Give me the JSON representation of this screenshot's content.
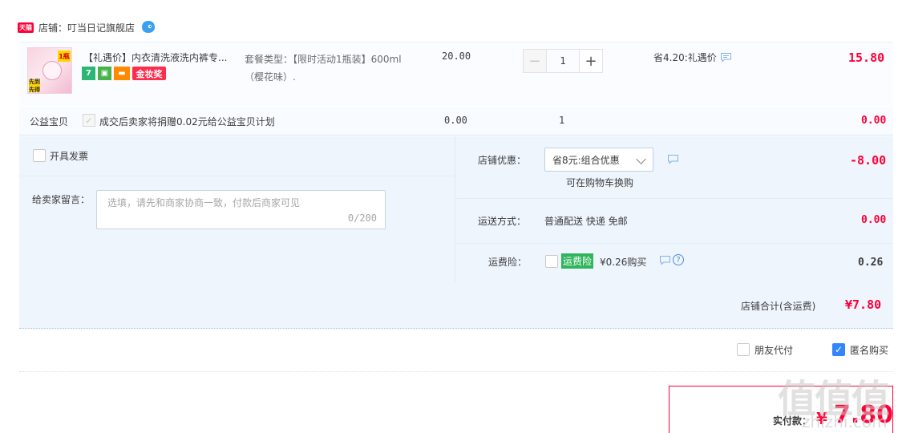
{
  "shop": {
    "badge": "天猫",
    "label": "店铺：叮当日记旗舰店"
  },
  "product": {
    "title": "【礼遇价】内衣清洗液洗内裤专...",
    "badge_seven": "7",
    "badge_gold": "金妆奖",
    "thumb_tag": "1瓶",
    "thumb_tag2": "先到先得",
    "sku": "套餐类型：【限时活动1瓶装】600ml（樱花味）.",
    "price": "20.00",
    "qty": "1",
    "promo": "省4.20:礼遇价",
    "subtotal": "15.80"
  },
  "charity": {
    "label": "公益宝贝",
    "text": "成交后卖家将捐赠0.02元给公益宝贝计划",
    "price": "0.00",
    "qty": "1",
    "subtotal": "0.00"
  },
  "invoice": {
    "label": "开具发票"
  },
  "message": {
    "label": "给卖家留言：",
    "placeholder": "选填，请先和商家协商一致，付款后商家可见",
    "count": "0/200"
  },
  "coupon": {
    "label": "店铺优惠：",
    "selected": "省8元:组合优惠",
    "note": "可在购物车换购",
    "amount": "-8.00"
  },
  "shipping": {
    "label": "运送方式：",
    "value": "普通配送 快递 免邮",
    "amount": "0.00"
  },
  "insurance": {
    "label": "运费险：",
    "badge": "运费险",
    "text": "¥0.26购买",
    "amount": "0.26"
  },
  "shop_total": {
    "label": "店铺合计(含运费)",
    "amount": "¥7.80"
  },
  "options": {
    "friend_pay": "朋友代付",
    "anonymous": "匿名购买",
    "anonymous_checked": true
  },
  "pay": {
    "label": "实付款：",
    "yen": "¥",
    "amount": "7.80"
  },
  "watermark": {
    "text": "值值值",
    "url": "zhizhi.com"
  },
  "colors": {
    "price_red": "#ff0036",
    "panel_bg": "#eff5fd",
    "check_blue": "#3385ff"
  }
}
